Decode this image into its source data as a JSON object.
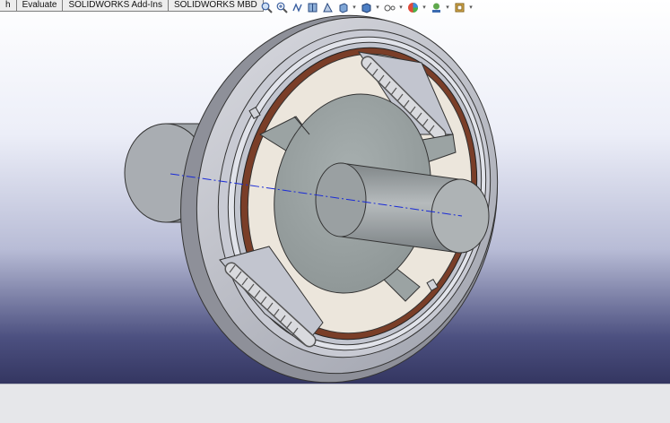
{
  "tabs": [
    {
      "label": "h"
    },
    {
      "label": "Evaluate"
    },
    {
      "label": "SOLIDWORKS Add-Ins"
    },
    {
      "label": "SOLIDWORKS MBD"
    }
  ],
  "view_toolbar": {
    "icons": [
      "zoom-to-fit-icon",
      "zoom-to-area-icon",
      "previous-view-icon",
      "section-view-icon",
      "dynamic-annotation-views-icon",
      "view-orientation-icon",
      "display-style-icon",
      "hide-show-items-icon",
      "edit-appearance-icon",
      "apply-scene-icon",
      "view-settings-icon"
    ]
  },
  "model": {
    "name": "centrifugal-clutch",
    "colors": {
      "housing": "#c9cad2",
      "friction_lining": "#7a3e28",
      "shoe": "#ede4d6",
      "hub": "#9aa3a3",
      "shaft": "#a8aeb0",
      "spring": "#d8d9de",
      "axis_line": "#1a2bd6"
    }
  }
}
